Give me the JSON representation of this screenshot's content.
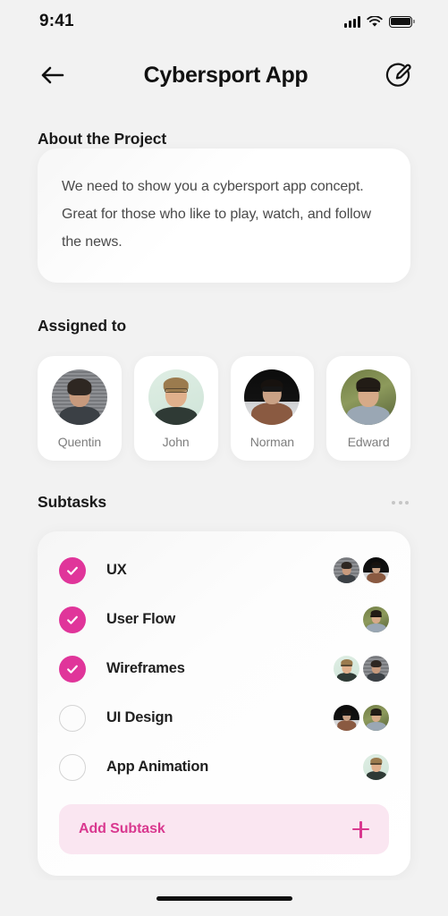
{
  "status_bar": {
    "time": "9:41",
    "signal_icon": "signal-bars-icon",
    "wifi_icon": "wifi-icon",
    "battery_icon": "battery-full-icon"
  },
  "navbar": {
    "back_icon": "back-arrow-icon",
    "title": "Cybersport App",
    "edit_icon": "edit-pencil-icon"
  },
  "about": {
    "title": "About the Project",
    "description": "We need to show you a cybersport app concept. Great for those who like to play, watch, and follow the news."
  },
  "assigned": {
    "title": "Assigned to",
    "people": [
      {
        "name": "Quentin",
        "avatar": "avatar-quentin"
      },
      {
        "name": "John",
        "avatar": "avatar-john"
      },
      {
        "name": "Norman",
        "avatar": "avatar-norman"
      },
      {
        "name": "Edward",
        "avatar": "avatar-edward"
      }
    ]
  },
  "subtasks": {
    "title": "Subtasks",
    "more_icon": "more-options-icon",
    "items": [
      {
        "label": "UX",
        "done": true,
        "avatars": [
          "avatar-quentin",
          "avatar-norman"
        ]
      },
      {
        "label": "User Flow",
        "done": true,
        "avatars": [
          "avatar-edward"
        ]
      },
      {
        "label": "Wireframes",
        "done": true,
        "avatars": [
          "avatar-john",
          "avatar-quentin"
        ]
      },
      {
        "label": "UI Design",
        "done": false,
        "avatars": [
          "avatar-norman",
          "avatar-edward"
        ]
      },
      {
        "label": "App Animation",
        "done": false,
        "avatars": [
          "avatar-john"
        ]
      }
    ],
    "add_label": "Add Subtask",
    "add_icon": "plus-icon"
  },
  "home_indicator": "home-indicator-bar",
  "colors": {
    "accent": "#e0359a",
    "accent_text": "#d9388f",
    "accent_soft_bg": "#fae6f1",
    "page_bg": "#f2f2f2",
    "card_bg": "#ffffff",
    "text_primary": "#1a1a1a",
    "text_secondary": "#4a4a4a",
    "text_muted": "#7d7d7d"
  }
}
